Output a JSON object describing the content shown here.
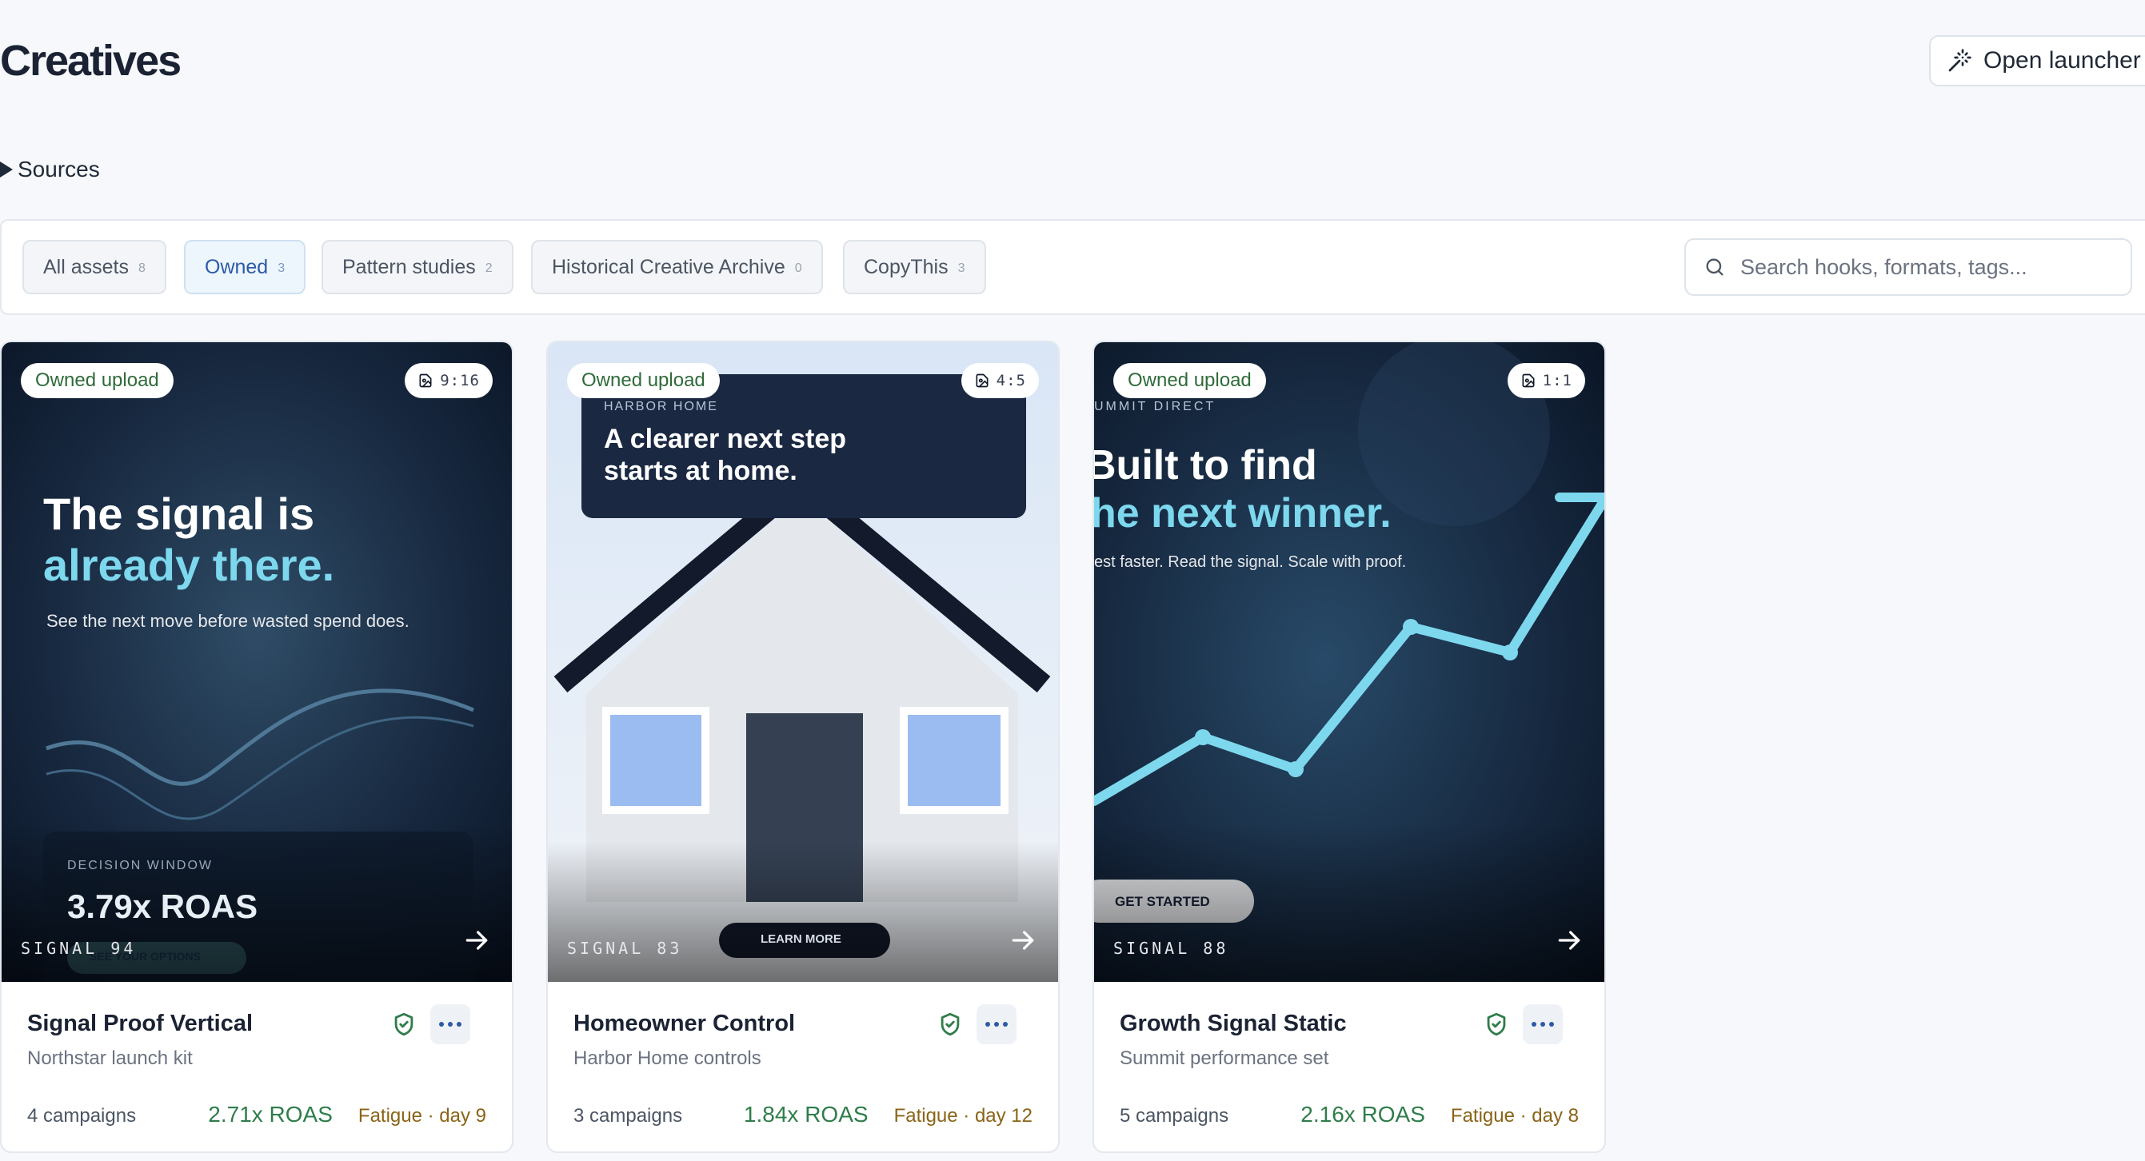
{
  "header": {
    "title": "Creatives",
    "launcher_label": "Open launcher"
  },
  "sources": {
    "label": "Sources"
  },
  "filters": [
    {
      "label": "All assets",
      "count": "8",
      "active": false
    },
    {
      "label": "Owned",
      "count": "3",
      "active": true
    },
    {
      "label": "Pattern studies",
      "count": "2",
      "active": false
    },
    {
      "label": "Historical Creative Archive",
      "count": "0",
      "active": false
    },
    {
      "label": "CopyThis",
      "count": "3",
      "active": false
    }
  ],
  "search": {
    "placeholder": "Search hooks, formats, tags..."
  },
  "cards": [
    {
      "badge": "Owned upload",
      "ratio": "9:16",
      "signal": "SIGNAL 94",
      "ad": {
        "headline_1": "The signal is",
        "headline_2": "already there.",
        "subline": "See the next move before wasted spend does.",
        "panel_label": "DECISION WINDOW",
        "panel_value": "3.79x ROAS",
        "cta": "SEE YOUR OPTIONS"
      },
      "title": "Signal Proof Vertical",
      "subtitle": "Northstar launch kit",
      "campaigns": "4 campaigns",
      "roas": "2.71x ROAS",
      "fatigue": "Fatigue · day 9"
    },
    {
      "badge": "Owned upload",
      "ratio": "4:5",
      "signal": "SIGNAL 83",
      "ad": {
        "brand": "HARBOR HOME",
        "headline_1": "A clearer next step",
        "headline_2": "starts at home.",
        "cta": "LEARN MORE"
      },
      "title": "Homeowner Control",
      "subtitle": "Harbor Home controls",
      "campaigns": "3 campaigns",
      "roas": "1.84x ROAS",
      "fatigue": "Fatigue · day 12"
    },
    {
      "badge": "Owned upload",
      "ratio": "1:1",
      "signal": "SIGNAL 88",
      "ad": {
        "brand": "UMMIT DIRECT",
        "headline_1": "Built to find",
        "headline_2": "he next winner.",
        "subline": "est faster. Read the signal. Scale with proof.",
        "cta": "GET STARTED"
      },
      "title": "Growth Signal Static",
      "subtitle": "Summit performance set",
      "campaigns": "5 campaigns",
      "roas": "2.16x ROAS",
      "fatigue": "Fatigue · day 8"
    }
  ],
  "icons": {
    "launcher": "magic-wand-icon",
    "search": "search-icon",
    "ratio": "image-file-icon",
    "arrow": "arrow-right-icon",
    "shield": "shield-check-icon",
    "more": "more-horizontal-icon"
  },
  "colors": {
    "accent_blue": "#2c5aa7",
    "roas_green": "#2f7d4a",
    "fatigue_amber": "#8a6417",
    "owned_green": "#2f6b3a",
    "ad_cyan": "#7dd8ee"
  }
}
